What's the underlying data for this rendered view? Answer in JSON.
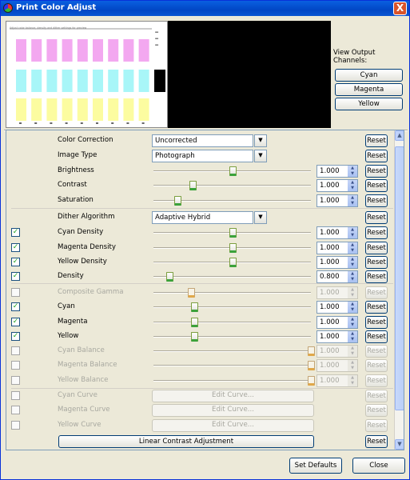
{
  "window": {
    "title": "Print Color Adjust",
    "close_glyph": "X"
  },
  "preview": {
    "header_text": "Adjust color balance, density and dither settings for preview",
    "row_colors": [
      "#F3A8F0",
      "#A8F6F8",
      "#FCFCA0"
    ],
    "black_swatch": "#000000"
  },
  "channels": {
    "label": "View Output Channels:",
    "buttons": [
      "Cyan",
      "Magenta",
      "Yellow"
    ]
  },
  "rows": [
    {
      "label": "Color Correction",
      "type": "dropdown",
      "value": "Uncorrected",
      "enabled": true,
      "reset": "Reset"
    },
    {
      "label": "Image Type",
      "type": "dropdown",
      "value": "Photograph",
      "enabled": true,
      "reset": "Reset"
    },
    {
      "label": "Brightness",
      "type": "slider",
      "slider": 0.5,
      "value": "1.000",
      "enabled": true,
      "reset": "Reset"
    },
    {
      "label": "Contrast",
      "type": "slider",
      "slider": 0.25,
      "value": "1.000",
      "enabled": true,
      "reset": "Reset"
    },
    {
      "label": "Saturation",
      "type": "slider",
      "slider": 0.15,
      "value": "1.000",
      "enabled": true,
      "reset": "Reset"
    },
    {
      "label": "Dither Algorithm",
      "type": "dropdown",
      "value": "Adaptive Hybrid",
      "enabled": true,
      "reset": "Reset"
    },
    {
      "label": "Cyan Density",
      "type": "slider",
      "checkbox": true,
      "checked": true,
      "slider": 0.5,
      "value": "1.000",
      "enabled": true,
      "reset": "Reset"
    },
    {
      "label": "Magenta Density",
      "type": "slider",
      "checkbox": true,
      "checked": true,
      "slider": 0.5,
      "value": "1.000",
      "enabled": true,
      "reset": "Reset"
    },
    {
      "label": "Yellow Density",
      "type": "slider",
      "checkbox": true,
      "checked": true,
      "slider": 0.5,
      "value": "1.000",
      "enabled": true,
      "reset": "Reset"
    },
    {
      "label": "Density",
      "type": "slider",
      "checkbox": true,
      "checked": true,
      "slider": 0.1,
      "value": "0.800",
      "enabled": true,
      "reset": "Reset"
    },
    {
      "label": "Composite Gamma",
      "type": "slider",
      "checkbox": true,
      "checked": false,
      "slider": 0.24,
      "value": "1.000",
      "enabled": false,
      "reset": "Reset"
    },
    {
      "label": "Cyan",
      "type": "slider",
      "checkbox": true,
      "checked": true,
      "slider": 0.26,
      "value": "1.000",
      "enabled": true,
      "reset": "Reset"
    },
    {
      "label": "Magenta",
      "type": "slider",
      "checkbox": true,
      "checked": true,
      "slider": 0.26,
      "value": "1.000",
      "enabled": true,
      "reset": "Reset"
    },
    {
      "label": "Yellow",
      "type": "slider",
      "checkbox": true,
      "checked": true,
      "slider": 0.26,
      "value": "1.000",
      "enabled": true,
      "reset": "Reset"
    },
    {
      "label": "Cyan Balance",
      "type": "slider",
      "checkbox": true,
      "checked": false,
      "slider": 1.0,
      "value": "1.000",
      "enabled": false,
      "reset": "Reset"
    },
    {
      "label": "Magenta Balance",
      "type": "slider",
      "checkbox": true,
      "checked": false,
      "slider": 1.0,
      "value": "1.000",
      "enabled": false,
      "reset": "Reset"
    },
    {
      "label": "Yellow Balance",
      "type": "slider",
      "checkbox": true,
      "checked": false,
      "slider": 1.0,
      "value": "1.000",
      "enabled": false,
      "reset": "Reset"
    },
    {
      "label": "Cyan Curve",
      "type": "curve",
      "checkbox": true,
      "checked": false,
      "value": "Edit Curve...",
      "enabled": false,
      "reset": "Reset"
    },
    {
      "label": "Magenta Curve",
      "type": "curve",
      "checkbox": true,
      "checked": false,
      "value": "Edit Curve...",
      "enabled": false,
      "reset": "Reset"
    },
    {
      "label": "Yellow Curve",
      "type": "curve",
      "checkbox": true,
      "checked": false,
      "value": "Edit Curve...",
      "enabled": false,
      "reset": "Reset"
    },
    {
      "label": "Linear Contrast Adjustment",
      "type": "bigbutton",
      "enabled": true,
      "reset": "Reset"
    }
  ],
  "footer": {
    "set_defaults": "Set Defaults",
    "close": "Close"
  }
}
